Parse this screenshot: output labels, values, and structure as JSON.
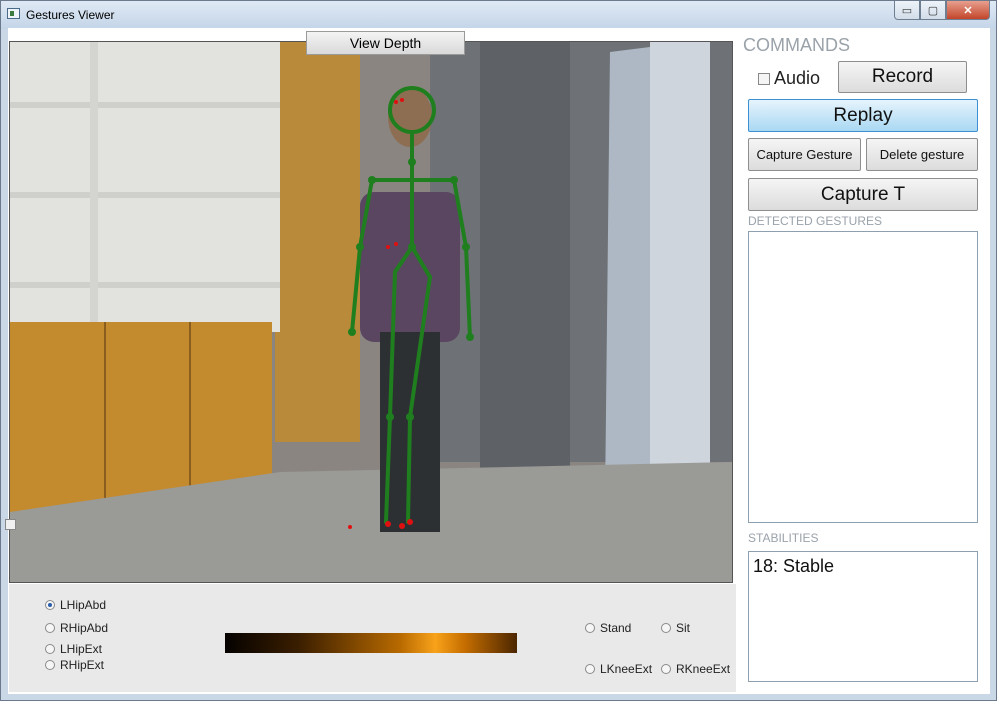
{
  "window": {
    "title": "Gestures Viewer"
  },
  "titlebar_buttons": {
    "minimize": "▭",
    "maximize": "▢",
    "close": "✕"
  },
  "video": {
    "toggle_label": "View Depth"
  },
  "joint_radios": [
    {
      "label": "LHipAbd",
      "selected": true
    },
    {
      "label": "RHipAbd",
      "selected": false
    },
    {
      "label": "LHipExt",
      "selected": false
    },
    {
      "label": "RHipExt",
      "selected": false
    }
  ],
  "pose_radios": [
    {
      "label": "Stand",
      "selected": false
    },
    {
      "label": "Sit",
      "selected": false
    },
    {
      "label": "LKneeExt",
      "selected": false
    },
    {
      "label": "RKneeExt",
      "selected": false
    }
  ],
  "commands": {
    "heading": "COMMANDS",
    "audio_label": "Audio",
    "audio_checked": false,
    "record_label": "Record",
    "replay_label": "Replay",
    "capture_gesture_label": "Capture Gesture",
    "delete_gesture_label": "Delete gesture",
    "capture_t_label": "Capture T"
  },
  "detected_gestures": {
    "label": "DETECTED GESTURES",
    "items": []
  },
  "stabilities": {
    "label": "STABILITIES",
    "value": "18: Stable"
  },
  "colors": {
    "skeleton": "#1f7f1f",
    "accent_button": "#3c8fd0",
    "heading_gray": "#9aa2aa"
  }
}
